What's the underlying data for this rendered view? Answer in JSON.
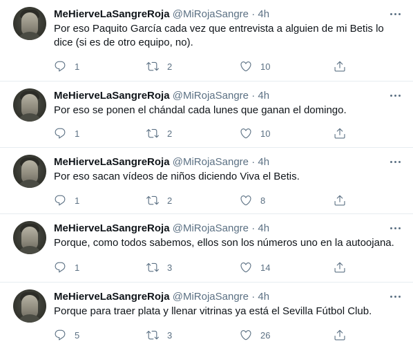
{
  "colors": {
    "text": "#0f1419",
    "secondary": "#5b7083",
    "divider": "#e6ecf0"
  },
  "icons": {
    "reply": "reply-icon",
    "retweet": "retweet-icon",
    "like": "heart-icon",
    "share": "share-icon",
    "more": "more-icon"
  },
  "tweets": [
    {
      "name": "MeHierveLaSangreRoja",
      "handle": "@MiRojaSangre",
      "sep": "·",
      "time": "4h",
      "text": "Por eso Paquito García cada vez que entrevista a alguien de mi Betis lo dice (si es de otro equipo, no).",
      "replies": "1",
      "retweets": "2",
      "likes": "10"
    },
    {
      "name": "MeHierveLaSangreRoja",
      "handle": "@MiRojaSangre",
      "sep": "·",
      "time": "4h",
      "text": "Por eso se ponen el chándal cada lunes que ganan el domingo.",
      "replies": "1",
      "retweets": "2",
      "likes": "10"
    },
    {
      "name": "MeHierveLaSangreRoja",
      "handle": "@MiRojaSangre",
      "sep": "·",
      "time": "4h",
      "text": "Por eso sacan vídeos de niños diciendo Viva el Betis.",
      "replies": "1",
      "retweets": "2",
      "likes": "8"
    },
    {
      "name": "MeHierveLaSangreRoja",
      "handle": "@MiRojaSangre",
      "sep": "·",
      "time": "4h",
      "text": "Porque, como todos sabemos, ellos son los números uno en la autoojana.",
      "replies": "1",
      "retweets": "3",
      "likes": "14"
    },
    {
      "name": "MeHierveLaSangreRoja",
      "handle": "@MiRojaSangre",
      "sep": "·",
      "time": "4h",
      "text": "Porque para traer plata y llenar vitrinas ya está el Sevilla Fútbol Club.",
      "replies": "5",
      "retweets": "3",
      "likes": "26"
    }
  ]
}
